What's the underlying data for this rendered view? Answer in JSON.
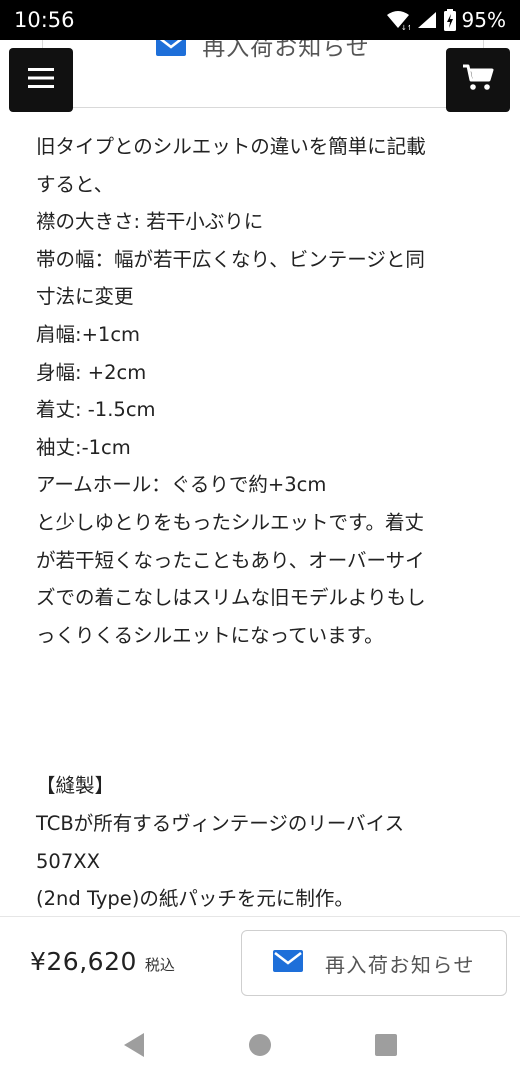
{
  "status_bar": {
    "time": "10:56",
    "battery": "95%",
    "icons": [
      "wifi-icon",
      "cellular-signal-icon",
      "battery-charging-icon"
    ]
  },
  "top_notify": {
    "label": "再入荷お知らせ",
    "icon": "mail-icon"
  },
  "fabs": {
    "menu_icon": "hamburger-menu-icon",
    "cart_icon": "shopping-cart-icon"
  },
  "description": {
    "lines": [
      "旧タイプとのシルエットの違いを簡単に記載",
      "すると、",
      "襟の大きさ: 若干小ぶりに",
      "帯の幅：幅が若干広くなり、ビンテージと同",
      "寸法に変更",
      "肩幅:+1cm",
      "身幅: +2cm",
      "着丈: -1.5cm",
      "袖丈:-1cm",
      "アームホール：ぐるりで約+3cm",
      "と少しゆとりをもったシルエットです。着丈",
      "が若干短くなったこともあり、オーバーサイ",
      "ズでの着こなしはスリムな旧モデルよりもし",
      "っくりくるシルエットになっています。"
    ],
    "sewing_lines": [
      "【縫製】",
      "TCBが所有するヴィンテージのリーバイス",
      "507XX",
      "(2nd Type)の紙パッチを元に制作。"
    ]
  },
  "bottom_bar": {
    "price": "¥26,620",
    "tax_label": "税込",
    "restock_label": "再入荷お知らせ"
  },
  "colors": {
    "accent_blue": "#1e6fd9",
    "fab_bg": "#111111"
  },
  "nav_bar": [
    "back-icon",
    "home-icon",
    "recents-icon"
  ]
}
